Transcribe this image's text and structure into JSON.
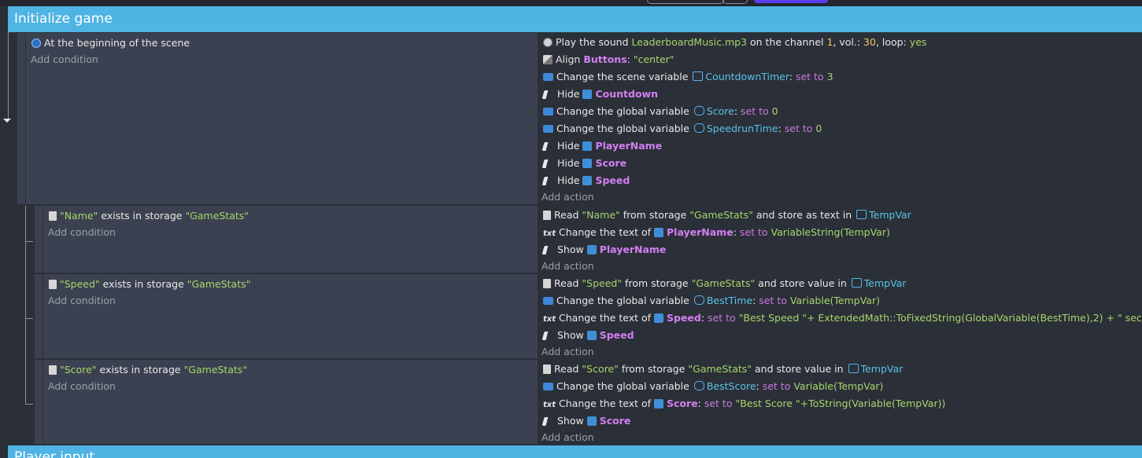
{
  "top_event": {
    "title": "Initialize game"
  },
  "next_event": {
    "title": "Player input"
  },
  "events": [
    {
      "conditions": [
        {
          "icon": "scene-start-icon",
          "text": "At the beginning of the scene"
        }
      ],
      "add_condition": "Add condition",
      "actions": [
        {
          "icon": "sound-icon",
          "parts": [
            [
              "",
              "Play the sound "
            ],
            [
              "g",
              "LeaderboardMusic.mp3"
            ],
            [
              "",
              " on the channel "
            ],
            [
              "y",
              "1"
            ],
            [
              "",
              ", vol.: "
            ],
            [
              "y",
              "30"
            ],
            [
              "",
              ", loop: "
            ],
            [
              "g",
              "yes"
            ]
          ]
        },
        {
          "icon": "align-icon",
          "parts": [
            [
              "",
              "Align "
            ],
            [
              "pb",
              "Buttons"
            ],
            [
              "",
              ": "
            ],
            [
              "g",
              "\"center\""
            ]
          ]
        },
        {
          "icon": "variable-icon",
          "parts": [
            [
              "",
              "Change the scene variable "
            ],
            [
              "sv",
              ""
            ],
            [
              "c",
              "CountdownTimer"
            ],
            [
              "",
              ": "
            ],
            [
              "p",
              "set to"
            ],
            [
              "",
              " "
            ],
            [
              "g",
              "3"
            ]
          ]
        },
        {
          "icon": "hide-icon",
          "parts": [
            [
              "",
              "Hide "
            ],
            [
              "obj",
              ""
            ],
            [
              "pb",
              "Countdown"
            ]
          ]
        },
        {
          "icon": "variable-icon",
          "parts": [
            [
              "",
              "Change the global variable "
            ],
            [
              "gv",
              ""
            ],
            [
              "c",
              "Score"
            ],
            [
              "",
              ": "
            ],
            [
              "p",
              "set to"
            ],
            [
              "",
              " "
            ],
            [
              "g",
              "0"
            ]
          ]
        },
        {
          "icon": "variable-icon",
          "parts": [
            [
              "",
              "Change the global variable "
            ],
            [
              "gv",
              ""
            ],
            [
              "c",
              "SpeedrunTime"
            ],
            [
              "",
              ": "
            ],
            [
              "p",
              "set to"
            ],
            [
              "",
              " "
            ],
            [
              "g",
              "0"
            ]
          ]
        },
        {
          "icon": "hide-icon",
          "parts": [
            [
              "",
              "Hide "
            ],
            [
              "obj",
              ""
            ],
            [
              "pb",
              "PlayerName"
            ]
          ]
        },
        {
          "icon": "hide-icon",
          "parts": [
            [
              "",
              "Hide "
            ],
            [
              "obj",
              ""
            ],
            [
              "pb",
              "Score"
            ]
          ]
        },
        {
          "icon": "hide-icon",
          "parts": [
            [
              "",
              "Hide "
            ],
            [
              "obj",
              ""
            ],
            [
              "pb",
              "Speed"
            ]
          ]
        }
      ],
      "add_action": "Add action"
    },
    {
      "conditions": [
        {
          "icon": "storage-icon",
          "parts": [
            [
              "g",
              "\"Name\""
            ],
            [
              "",
              " exists in storage "
            ],
            [
              "g",
              "\"GameStats\""
            ]
          ]
        }
      ],
      "add_condition": "Add condition",
      "actions": [
        {
          "icon": "storage-icon",
          "parts": [
            [
              "",
              "Read "
            ],
            [
              "g",
              "\"Name\""
            ],
            [
              "",
              " from storage "
            ],
            [
              "g",
              "\"GameStats\""
            ],
            [
              "",
              " and store as text in "
            ],
            [
              "sv",
              ""
            ],
            [
              "c",
              "TempVar"
            ]
          ]
        },
        {
          "icon": "text-icon",
          "parts": [
            [
              "",
              "Change the text of "
            ],
            [
              "obj",
              ""
            ],
            [
              "pb",
              "PlayerName"
            ],
            [
              "",
              ": "
            ],
            [
              "p",
              "set to"
            ],
            [
              "",
              " "
            ],
            [
              "g",
              "VariableString(TempVar)"
            ]
          ]
        },
        {
          "icon": "hide-icon",
          "parts": [
            [
              "",
              "Show "
            ],
            [
              "obj",
              ""
            ],
            [
              "pb",
              "PlayerName"
            ]
          ]
        }
      ],
      "add_action": "Add action"
    },
    {
      "conditions": [
        {
          "icon": "storage-icon",
          "parts": [
            [
              "g",
              "\"Speed\""
            ],
            [
              "",
              " exists in storage "
            ],
            [
              "g",
              "\"GameStats\""
            ]
          ]
        }
      ],
      "add_condition": "Add condition",
      "actions": [
        {
          "icon": "storage-icon",
          "parts": [
            [
              "",
              "Read "
            ],
            [
              "g",
              "\"Speed\""
            ],
            [
              "",
              " from storage "
            ],
            [
              "g",
              "\"GameStats\""
            ],
            [
              "",
              " and store value in "
            ],
            [
              "sv",
              ""
            ],
            [
              "c",
              "TempVar"
            ]
          ]
        },
        {
          "icon": "variable-icon",
          "parts": [
            [
              "",
              "Change the global variable "
            ],
            [
              "gv",
              ""
            ],
            [
              "c",
              "BestTime"
            ],
            [
              "",
              ": "
            ],
            [
              "p",
              "set to"
            ],
            [
              "",
              " "
            ],
            [
              "g",
              "Variable(TempVar)"
            ]
          ]
        },
        {
          "icon": "text-icon",
          "parts": [
            [
              "",
              "Change the text of "
            ],
            [
              "obj",
              ""
            ],
            [
              "pb",
              "Speed"
            ],
            [
              "",
              ": "
            ],
            [
              "p",
              "set to"
            ],
            [
              "",
              " "
            ],
            [
              "g",
              "\"Best Speed \"+ ExtendedMath::ToFixedString(GlobalVariable(BestTime),2) + \" sec\""
            ]
          ]
        },
        {
          "icon": "hide-icon",
          "parts": [
            [
              "",
              "Show "
            ],
            [
              "obj",
              ""
            ],
            [
              "pb",
              "Speed"
            ]
          ]
        }
      ],
      "add_action": "Add action"
    },
    {
      "conditions": [
        {
          "icon": "storage-icon",
          "parts": [
            [
              "g",
              "\"Score\""
            ],
            [
              "",
              " exists in storage "
            ],
            [
              "g",
              "\"GameStats\""
            ]
          ]
        }
      ],
      "add_condition": "Add condition",
      "actions": [
        {
          "icon": "storage-icon",
          "parts": [
            [
              "",
              "Read "
            ],
            [
              "g",
              "\"Score\""
            ],
            [
              "",
              " from storage "
            ],
            [
              "g",
              "\"GameStats\""
            ],
            [
              "",
              " and store value in "
            ],
            [
              "sv",
              ""
            ],
            [
              "c",
              "TempVar"
            ]
          ]
        },
        {
          "icon": "variable-icon",
          "parts": [
            [
              "",
              "Change the global variable "
            ],
            [
              "gv",
              ""
            ],
            [
              "c",
              "BestScore"
            ],
            [
              "",
              ": "
            ],
            [
              "p",
              "set to"
            ],
            [
              "",
              " "
            ],
            [
              "g",
              "Variable(TempVar)"
            ]
          ]
        },
        {
          "icon": "text-icon",
          "parts": [
            [
              "",
              "Change the text of "
            ],
            [
              "obj",
              ""
            ],
            [
              "pb",
              "Score"
            ],
            [
              "",
              ": "
            ],
            [
              "p",
              "set to"
            ],
            [
              "",
              " "
            ],
            [
              "g",
              "\"Best Score \"+ToString(Variable(TempVar))"
            ]
          ]
        },
        {
          "icon": "hide-icon",
          "parts": [
            [
              "",
              "Show "
            ],
            [
              "obj",
              ""
            ],
            [
              "pb",
              "Score"
            ]
          ]
        }
      ],
      "add_action": "Add action"
    }
  ]
}
